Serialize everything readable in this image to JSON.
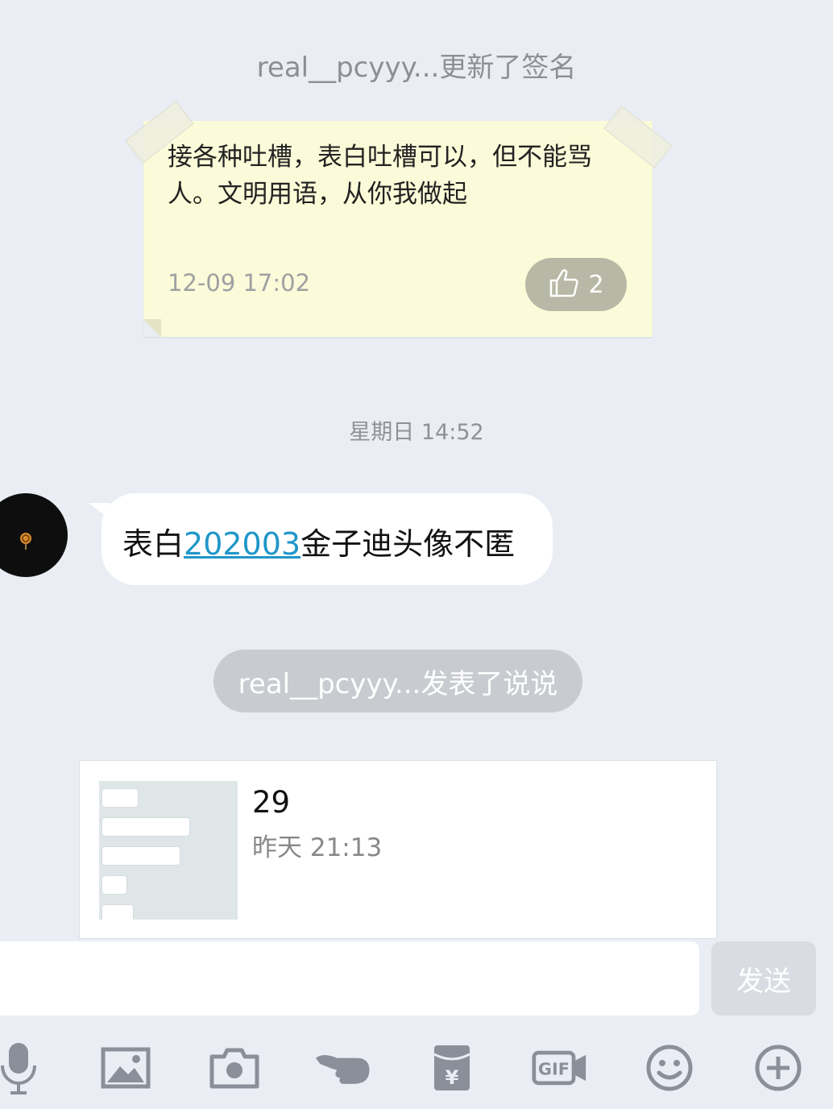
{
  "signature_notice": "real__pcyyy...更新了签名",
  "note": {
    "text": "接各种吐槽，表白吐槽可以，但不能骂人。文明用语，从你我做起",
    "time": "12-09 17:02",
    "likes": "2"
  },
  "timestamp": "星期日 14:52",
  "message": {
    "before": "表白",
    "link": "202003",
    "after": "金子迪头像不匿"
  },
  "post_notice": "real__pcyyy...发表了说说",
  "card": {
    "title": "29",
    "time": "昨天 21:13"
  },
  "input": {
    "send_label": "发送"
  },
  "toolbar": {
    "icons": [
      "microphone-icon",
      "image-icon",
      "camera-icon",
      "poke-icon",
      "red-packet-icon",
      "gif-icon",
      "emoji-icon",
      "plus-icon"
    ]
  },
  "colors": {
    "background": "#eaedf4",
    "note": "#fbfbd9",
    "link": "#1f97c9",
    "icon": "#8a8f99"
  }
}
